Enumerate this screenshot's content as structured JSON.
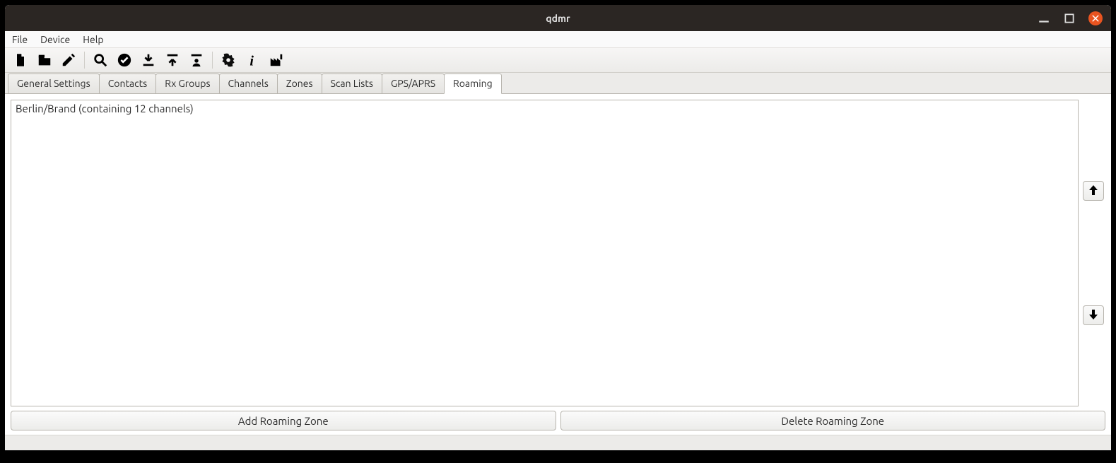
{
  "window": {
    "title": "qdmr"
  },
  "menu": {
    "file": "File",
    "device": "Device",
    "help": "Help"
  },
  "tabs": {
    "general": "General Settings",
    "contacts": "Contacts",
    "rxgroups": "Rx Groups",
    "channels": "Channels",
    "zones": "Zones",
    "scanlists": "Scan Lists",
    "gps": "GPS/APRS",
    "roaming": "Roaming"
  },
  "roaming": {
    "items": [
      {
        "label": "Berlin/Brand (containing 12 channels)"
      }
    ],
    "add_label": "Add Roaming Zone",
    "delete_label": "Delete Roaming Zone"
  }
}
